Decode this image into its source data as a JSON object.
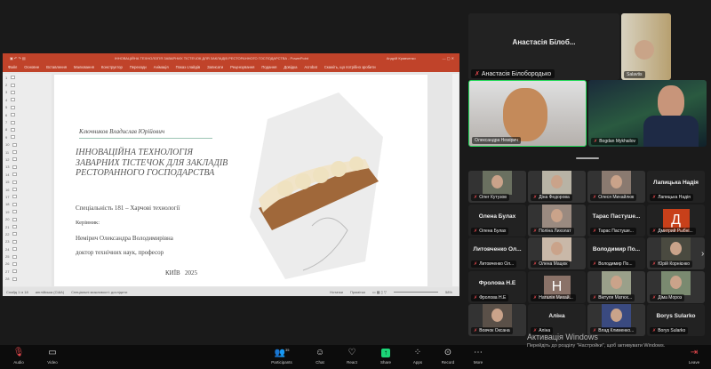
{
  "powerpoint": {
    "title": "ІННОВАЦІЙНА ТЕХНОЛОГІЯ ЗАВАРНИХ ТІСТЕЧОК ДЛЯ ЗАКЛАДІВ РЕСТОРАННОГО ГОСПОДАРСТВА - PowerPoint",
    "user": "Андрій Кравченко",
    "ribbon_tabs": [
      "Файл",
      "Основне",
      "Вставлення",
      "Малювання",
      "Конструктор",
      "Переходи",
      "Анімація",
      "Показ слайдів",
      "Записати",
      "Рецензування",
      "Подання",
      "Довідка",
      "Acrobat"
    ],
    "search": "Скажіть, що потрібно зробити",
    "slide_numbers": [
      "1",
      "2",
      "3",
      "4",
      "5",
      "6",
      "7",
      "8",
      "9",
      "10",
      "11",
      "12",
      "13",
      "14",
      "15",
      "16",
      "17",
      "18",
      "19",
      "20",
      "21",
      "22",
      "23",
      "24",
      "25",
      "26",
      "27",
      "28"
    ],
    "status": {
      "slide": "Слайд 1 із 18",
      "lang": "англійська (США)",
      "accessibility": "Спеціальні можливості: дослідити",
      "notes": "Нотатки",
      "comments": "Примітки",
      "zoom": "58%"
    }
  },
  "slide": {
    "author": "Ключников Владислав Юрійович",
    "title": "ІННОВАЦІЙНА ТЕХНОЛОГІЯ ЗАВАРНИХ ТІСТЕЧОК ДЛЯ ЗАКЛАДІВ РЕСТОРАННОГО ГОСПОДАРСТВА",
    "specialty": "Спеціальність 181 – Харчові технології",
    "supervisor_label": "Керівник:",
    "supervisor": "Немірич Олександра Володимирівна",
    "degree": "доктор технічних наук, професор",
    "city_year": "КИЇВ   2025"
  },
  "speakers": [
    {
      "big": "Анастасія Білоб...",
      "name": "Анастасія Білобородько"
    },
    {
      "name": "Salavtis"
    },
    {
      "name": "Олександра Немірич"
    },
    {
      "name": "Bogdan Mykhailov"
    }
  ],
  "gallery": [
    {
      "name": "Олег Кутузов",
      "video": "#6a7060"
    },
    {
      "name": "Діна Федорова",
      "video": "#b8b3a5"
    },
    {
      "name": "Олеся Михайлюк",
      "video": "#8a7a70"
    },
    {
      "name": "Лапицька Надія",
      "big": "Лапицька Надія"
    },
    {
      "name": "Олена Булах",
      "big": "Олена Булах"
    },
    {
      "name": "Поліна Лихолат",
      "video": "#9a8a80"
    },
    {
      "name": "Тарас Пастуше...",
      "big": "Тарас Пастуше..."
    },
    {
      "name": "Дмитрий Рыбні...",
      "avatar": "Д",
      "color": "#c8401a"
    },
    {
      "name": "Литовченко Ол...",
      "big": "Литовченко Ол..."
    },
    {
      "name": "Олена Мацюк",
      "video": "#c9b8a8"
    },
    {
      "name": "Володимир По...",
      "big": "Володимир По..."
    },
    {
      "name": "Юрій Корнієнко",
      "video": "#4a4a40"
    },
    {
      "name": "Фролова Н.Е",
      "big": "Фролова Н.Е"
    },
    {
      "name": "Наталія Михай...",
      "avatar": "Н",
      "color": "#8a7268"
    },
    {
      "name": "Віктуля Матюх...",
      "video": "#9aa08a"
    },
    {
      "name": "Діма Мороз",
      "video": "#7a8a70"
    },
    {
      "name": "Вовчок Оксана",
      "video": "#5a5048"
    },
    {
      "name": "Аліна",
      "big": "Аліна"
    },
    {
      "name": "Влад Клименко...",
      "video": "#3a4a80"
    },
    {
      "name": "Borys Sularko",
      "big": "Borys Sularko"
    }
  ],
  "watermark": {
    "title": "Активація Windows",
    "sub": "Перейдіть до розділу \"Настройки\", щоб активувати Windows."
  },
  "toolbar": {
    "audio": "Audio",
    "video": "Video",
    "participants": "Participants",
    "participants_count": "35",
    "chat": "Chat",
    "react": "React",
    "share": "Share",
    "apps": "Apps",
    "record": "Record",
    "more": "More",
    "leave": "Leave"
  },
  "colors": {
    "ppt": "#c0432a",
    "active_speaker": "#23d959",
    "share": "#1bd677",
    "mute": "#e5484d"
  }
}
